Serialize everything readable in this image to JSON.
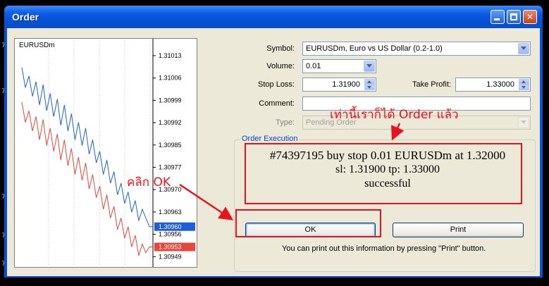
{
  "window": {
    "title": "Order",
    "minimize_icon": "minimize-icon",
    "maximize_icon": "maximize-icon",
    "close_icon": "close-icon",
    "close_glyph": "✕"
  },
  "background": {
    "marks": [
      "7",
      "7",
      "7",
      "7",
      "7"
    ]
  },
  "chart": {
    "symbol": "EURUSDm",
    "price_labels": [
      "1.31013",
      "1.31006",
      "1.30999",
      "1.30992",
      "1.30985",
      "1.30977",
      "1.30970",
      "1.30963",
      "1.30956",
      "1.30949"
    ],
    "ask_tag": "1.30960",
    "bid_tag": "1.30953",
    "ask_color": "#1f5fd6",
    "bid_color": "#e8453c",
    "chart_data": {
      "type": "line",
      "ylim": [
        1.30949,
        1.3102
      ],
      "series": [
        {
          "values": [
            1.31015,
            1.31008,
            1.31012,
            1.31005,
            1.3101,
            1.31002,
            1.31009,
            1.31,
            1.31006,
            1.30998,
            1.31004,
            1.30995,
            1.31002,
            1.30993,
            1.30999,
            1.3099,
            1.30996,
            1.30988,
            1.30994,
            1.30985,
            1.3099,
            1.30982,
            1.30986,
            1.30978,
            1.30983,
            1.30975,
            1.30979,
            1.30971,
            1.30975,
            1.30968,
            1.30972,
            1.30965,
            1.30969,
            1.30962,
            1.30966,
            1.30963,
            1.3096,
            1.3096
          ]
        },
        {
          "values": [
            1.31003,
            1.30996,
            1.31,
            1.30993,
            1.30998,
            1.3099,
            1.30997,
            1.30988,
            1.30994,
            1.30986,
            1.30992,
            1.30983,
            1.3099,
            1.30981,
            1.30987,
            1.30978,
            1.30984,
            1.30976,
            1.30982,
            1.30973,
            1.30978,
            1.3097,
            1.30974,
            1.30966,
            1.30971,
            1.30963,
            1.30967,
            1.30959,
            1.30963,
            1.30956,
            1.3096,
            1.30953,
            1.30957,
            1.3095,
            1.30954,
            1.30951,
            1.30953,
            1.30953
          ]
        }
      ]
    }
  },
  "form": {
    "symbol_label": "Symbol:",
    "symbol_value": "EURUSDm, Euro vs US Dollar (0.2-1.0)",
    "volume_label": "Volume:",
    "volume_value": "0.01",
    "stoploss_label": "Stop Loss:",
    "stoploss_value": "1.31900",
    "takeprofit_label": "Take Profit:",
    "takeprofit_value": "1.33000",
    "comment_label": "Comment:",
    "comment_value": "",
    "type_label": "Type:",
    "type_value": "Pending Order"
  },
  "execution": {
    "group_title": "Order Execution",
    "line1": "#74397195 buy stop 0.01 EURUSDm at 1.32000",
    "line2": "sl: 1.31900 tp: 1.33000",
    "line3": "successful",
    "ok_label": "OK",
    "print_label": "Print",
    "info": "You can print out this information by pressing \"Print\" button."
  },
  "annotations": {
    "click_ok": "คลิก OK",
    "done_order": "เท่านี้เราก็ได้ Order แล้ว",
    "color": "#e8121c"
  }
}
